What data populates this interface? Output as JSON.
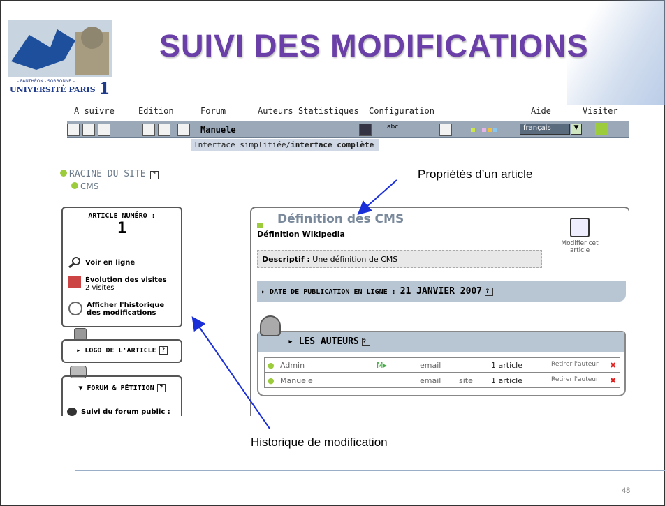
{
  "slide": {
    "title": "SUIVI DES MODIFICATIONS",
    "page_number": "48",
    "label_properties": "Propriétés d’un article",
    "label_history": "Historique de modification"
  },
  "logo": {
    "line1": "– PANTHÉON - SORBONNE –",
    "line2": "UNIVERSITÉ PARIS",
    "number": "1"
  },
  "menu": {
    "items": [
      "A suivre",
      "Edition",
      "Forum",
      "Auteurs",
      "Statistiques",
      "Configuration",
      "Aide",
      "Visiter"
    ]
  },
  "toolbar": {
    "user": "Manuele",
    "spell": "abc",
    "language": "français",
    "interface_simple": "Interface simplifiée/",
    "interface_full": "interface complète"
  },
  "tree": {
    "root": "RACINE DU SITE",
    "child": "CMS",
    "help": "?"
  },
  "article_box": {
    "heading": "ARTICLE NUMÉRO :",
    "number": "1",
    "view_online": "Voir en ligne",
    "visits_title": "Évolution des visites",
    "visits_count": "2 visites",
    "history_link": "Afficher l'historique des modifications"
  },
  "logo_box": {
    "label": "LOGO DE L'ARTICLE"
  },
  "forum_box": {
    "label": "FORUM & PÉTITION",
    "public": "Suivi du forum public :"
  },
  "article": {
    "title": "Définition des CMS",
    "subtitle": "Définition Wikipedia",
    "modify": "Modifier cet article",
    "descr_label": "Descriptif :",
    "descr_value": "Une définition de CMS",
    "date_label": "DATE DE PUBLICATION EN LIGNE :",
    "date_value": "21 JANVIER 2007"
  },
  "authors": {
    "heading": "LES AUTEURS",
    "rows": [
      {
        "name": "Admin",
        "msg": "M▸",
        "email": "email",
        "site": "",
        "count": "1 article",
        "remove": "Retirer l'auteur"
      },
      {
        "name": "Manuele",
        "msg": "",
        "email": "email",
        "site": "site",
        "count": "1 article",
        "remove": "Retirer l'auteur"
      }
    ]
  },
  "colors": {
    "title": "#6a3fa8",
    "toolbar": "#9aa8b8",
    "bar": "#b8c6d4",
    "accent_green": "#9ccb3c",
    "arrow": "#1a2fd8"
  }
}
